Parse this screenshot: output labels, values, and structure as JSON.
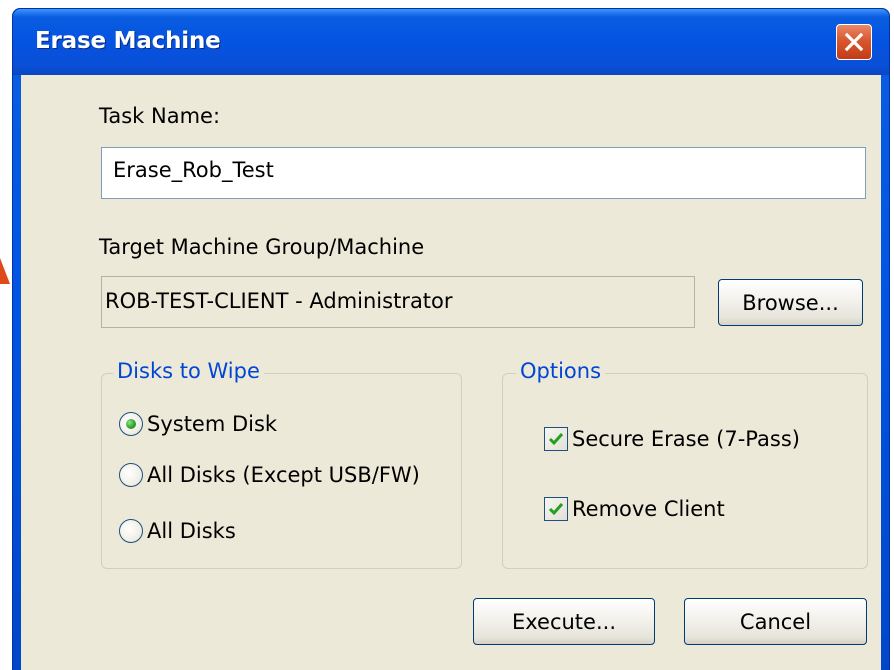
{
  "window": {
    "title": "Erase Machine"
  },
  "form": {
    "task_name_label": "Task Name:",
    "task_name_value": "Erase_Rob_Test",
    "target_label": "Target Machine Group/Machine",
    "target_value": "ROB-TEST-CLIENT - Administrator",
    "browse_label": "Browse..."
  },
  "disks": {
    "legend": "Disks to Wipe",
    "options": [
      {
        "label": "System Disk",
        "selected": true
      },
      {
        "label": "All Disks (Except USB/FW)",
        "selected": false
      },
      {
        "label": "All Disks",
        "selected": false
      }
    ]
  },
  "options": {
    "legend": "Options",
    "items": [
      {
        "label": "Secure Erase (7-Pass)",
        "checked": true
      },
      {
        "label": "Remove Client",
        "checked": true
      }
    ]
  },
  "buttons": {
    "execute_label": "Execute...",
    "cancel_label": "Cancel"
  },
  "colors": {
    "titlebar": "#0453e2",
    "dialog_bg": "#ece9d8",
    "group_legend": "#0046d5",
    "close_button": "#d9572f",
    "check_mark": "#21a121",
    "edge_marker": "#e04a1b"
  }
}
